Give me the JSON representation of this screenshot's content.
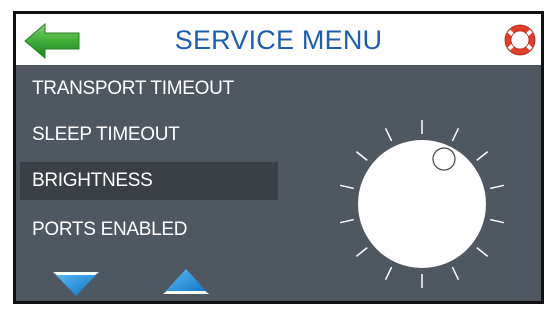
{
  "header": {
    "title": "SERVICE MENU",
    "back_icon": "back-arrow-icon",
    "help_icon": "lifebuoy-icon"
  },
  "menu": {
    "items": [
      {
        "label": "TRANSPORT TIMEOUT",
        "selected": false
      },
      {
        "label": "SLEEP TIMEOUT",
        "selected": false
      },
      {
        "label": "BRIGHTNESS",
        "selected": true
      },
      {
        "label": "PORTS ENABLED",
        "selected": false
      }
    ]
  },
  "navigation": {
    "down_icon": "down-triangle-icon",
    "up_icon": "up-triangle-icon"
  },
  "dial": {
    "icon": "rotary-knob-icon",
    "tick_count": 14
  },
  "colors": {
    "screen_bg": "#4f5761",
    "selected_bg": "#3b4047",
    "title": "#1d5eb3",
    "accent_blue": "#1e8ee0",
    "back_arrow": "#3aa637"
  }
}
